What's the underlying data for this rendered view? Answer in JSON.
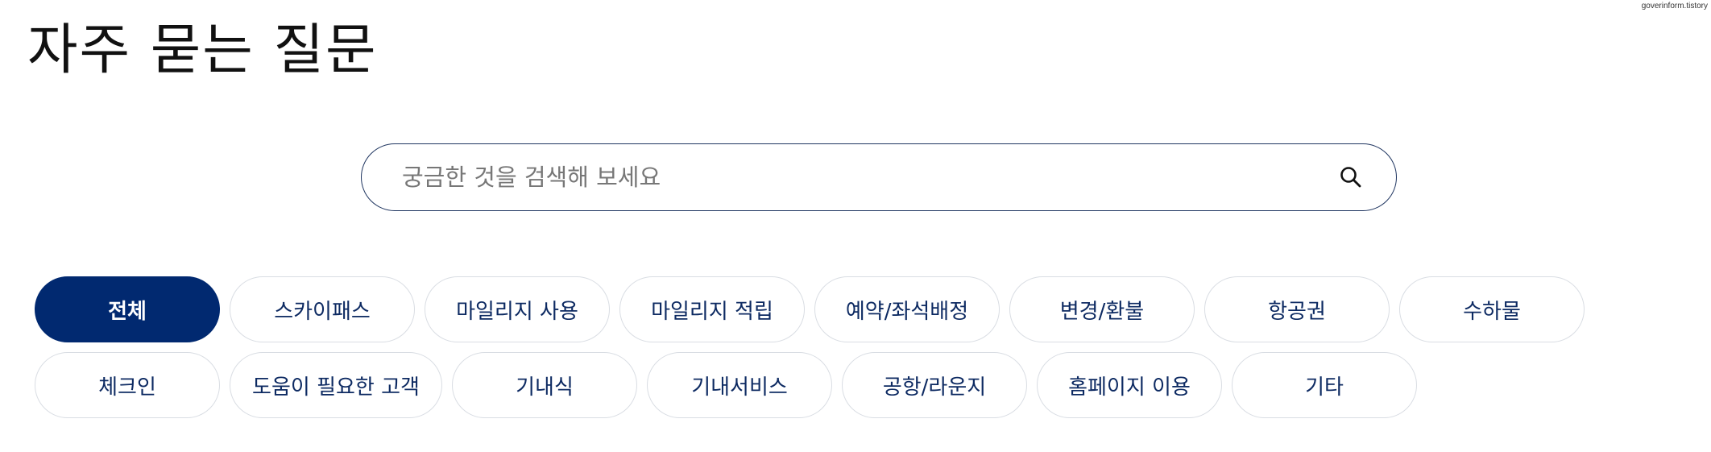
{
  "watermark": "goverinform.tistory",
  "page": {
    "title": "자주 묻는 질문"
  },
  "search": {
    "placeholder": "궁금한 것을 검색해 보세요",
    "value": ""
  },
  "colors": {
    "primary": "#012970",
    "chip_text": "#0d2a62",
    "chip_border": "#d9dde3"
  },
  "icons": {
    "search": "magnifier"
  },
  "categories": {
    "row1": [
      {
        "label": "전체",
        "active": true
      },
      {
        "label": "스카이패스",
        "active": false
      },
      {
        "label": "마일리지 사용",
        "active": false
      },
      {
        "label": "마일리지 적립",
        "active": false
      },
      {
        "label": "예약/좌석배정",
        "active": false
      },
      {
        "label": "변경/환불",
        "active": false
      },
      {
        "label": "항공권",
        "active": false
      },
      {
        "label": "수하물",
        "active": false
      }
    ],
    "row2": [
      {
        "label": "체크인",
        "active": false
      },
      {
        "label": "도움이 필요한 고객",
        "active": false
      },
      {
        "label": "기내식",
        "active": false
      },
      {
        "label": "기내서비스",
        "active": false
      },
      {
        "label": "공항/라운지",
        "active": false
      },
      {
        "label": "홈페이지 이용",
        "active": false
      },
      {
        "label": "기타",
        "active": false
      }
    ]
  }
}
